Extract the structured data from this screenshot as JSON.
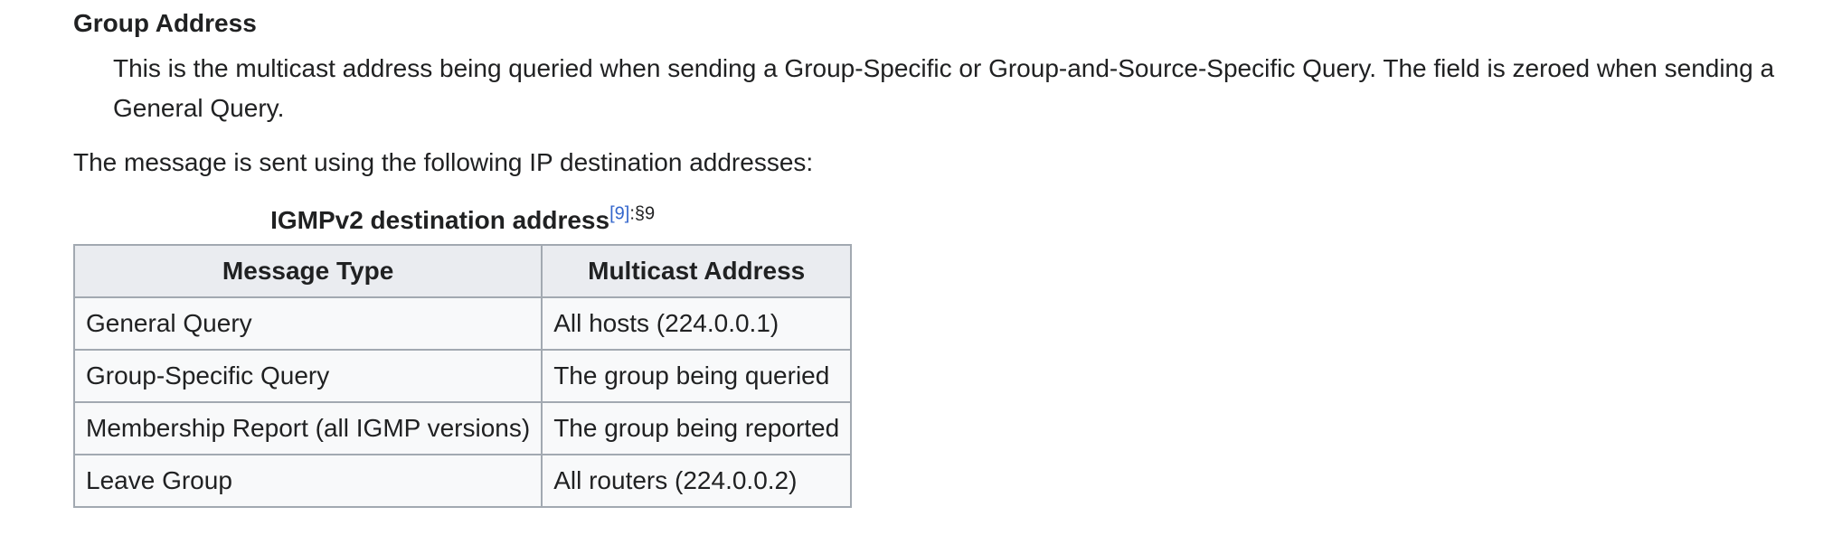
{
  "definition": {
    "term": "Group Address",
    "description": "This is the multicast address being queried when sending a Group-Specific or Group-and-Source-Specific Query. The field is zeroed when sending a General Query."
  },
  "paragraph": "The message is sent using the following IP destination addresses:",
  "table": {
    "caption": "IGMPv2 destination address",
    "citation": "[9]",
    "citation_suffix": ":§9",
    "headers": [
      "Message Type",
      "Multicast Address"
    ],
    "rows": [
      [
        "General Query",
        "All hosts (224.0.0.1)"
      ],
      [
        "Group-Specific Query",
        "The group being queried"
      ],
      [
        "Membership Report (all IGMP versions)",
        "The group being reported"
      ],
      [
        "Leave Group",
        "All routers (224.0.0.2)"
      ]
    ]
  },
  "colors": {
    "link": "#3366cc",
    "text": "#202122",
    "table_border": "#a2a9b1",
    "header_bg": "#eaecf0",
    "cell_bg": "#f8f9fa"
  }
}
